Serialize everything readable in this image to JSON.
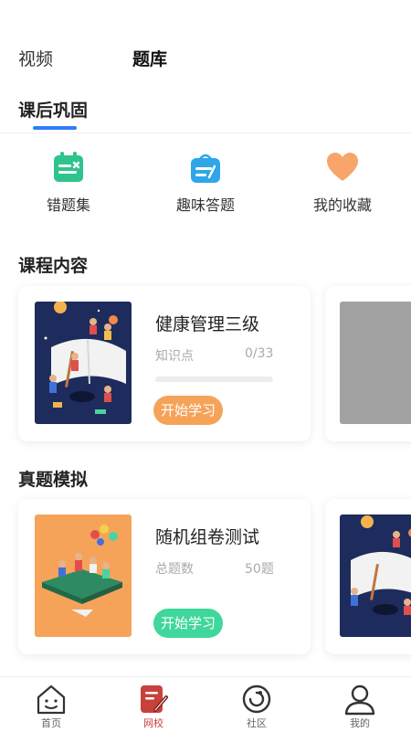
{
  "top_tabs": {
    "video": "视频",
    "question_bank": "题库"
  },
  "after_class": {
    "title": "课后巩固",
    "items": [
      {
        "label": "错题集",
        "icon": "mistakes-calendar-icon",
        "color": "#2ec48c"
      },
      {
        "label": "趣味答题",
        "icon": "fun-quiz-bag-icon",
        "color": "#2fa6ea"
      },
      {
        "label": "我的收藏",
        "icon": "heart-icon",
        "color": "#f7a56a"
      }
    ]
  },
  "course_content": {
    "title": "课程内容",
    "card": {
      "title": "健康管理三级",
      "meta_label": "知识点",
      "meta_value": "0/33",
      "progress": 0,
      "button": "开始学习"
    }
  },
  "exam_sim": {
    "title": "真题模拟",
    "card": {
      "title": "随机组卷测试",
      "meta_label": "总题数",
      "meta_value": "50题",
      "button": "开始学习"
    }
  },
  "bottom_nav": [
    {
      "label": "首页",
      "icon": "home-icon",
      "active": false
    },
    {
      "label": "网校",
      "icon": "online-school-icon",
      "active": true
    },
    {
      "label": "社区",
      "icon": "community-icon",
      "active": false
    },
    {
      "label": "我的",
      "icon": "profile-icon",
      "active": false
    }
  ],
  "colors": {
    "accent_blue": "#2f7cf6",
    "active_red": "#c9413b",
    "orange": "#f6a35a",
    "green": "#3fd79b"
  }
}
